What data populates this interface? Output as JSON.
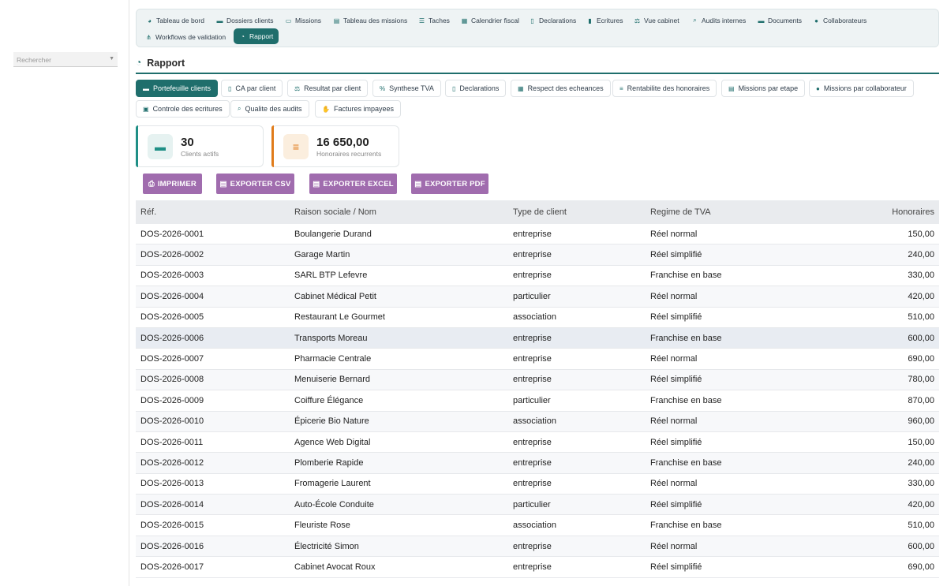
{
  "sidebar": {
    "search_placeholder": "Rechercher"
  },
  "topnav": {
    "items": [
      {
        "label": "Tableau de bord",
        "icon": "dashboard-icon"
      },
      {
        "label": "Dossiers clients",
        "icon": "folder-icon"
      },
      {
        "label": "Missions",
        "icon": "briefcase-icon"
      },
      {
        "label": "Tableau des missions",
        "icon": "table-icon"
      },
      {
        "label": "Taches",
        "icon": "list-icon"
      },
      {
        "label": "Calendrier fiscal",
        "icon": "calendar-icon"
      },
      {
        "label": "Declarations",
        "icon": "document-icon"
      },
      {
        "label": "Ecritures",
        "icon": "book-icon"
      },
      {
        "label": "Vue cabinet",
        "icon": "scale-icon"
      },
      {
        "label": "Audits internes",
        "icon": "search-icon"
      },
      {
        "label": "Documents",
        "icon": "folder-icon"
      },
      {
        "label": "Collaborateurs",
        "icon": "users-icon"
      },
      {
        "label": "Workflows de validation",
        "icon": "workflow-icon"
      },
      {
        "label": "Rapport",
        "icon": "pie-chart-icon",
        "active": true
      }
    ]
  },
  "page": {
    "title": "Rapport"
  },
  "tabs": [
    {
      "label": "Portefeuille clients",
      "icon": "folder-open-icon",
      "active": true
    },
    {
      "label": "CA par client",
      "icon": "invoice-icon"
    },
    {
      "label": "Resultat par client",
      "icon": "scale-icon"
    },
    {
      "label": "Synthese TVA",
      "icon": "percent-icon"
    },
    {
      "label": "Declarations",
      "icon": "document-icon"
    },
    {
      "label": "Respect des echeances",
      "icon": "calendar-check-icon"
    },
    {
      "label": "Rentabilite des honoraires",
      "icon": "coins-icon"
    },
    {
      "label": "Missions par etape",
      "icon": "columns-icon"
    },
    {
      "label": "Missions par collaborateur",
      "icon": "users-icon"
    },
    {
      "label": "Controle des ecritures",
      "icon": "clipboard-check-icon"
    },
    {
      "label": "Qualite des audits",
      "icon": "search-icon"
    },
    {
      "label": "Factures impayees",
      "icon": "hand-money-icon"
    }
  ],
  "kpis": [
    {
      "value": "30",
      "label": "Clients actifs",
      "icon": "folder-open-icon",
      "color": "#1f8f86",
      "bg": "#e6f2f1"
    },
    {
      "value": "16 650,00",
      "label": "Honoraires recurrents",
      "icon": "coins-icon",
      "color": "#e07b1a",
      "bg": "#fbeede"
    }
  ],
  "actions": [
    {
      "label": "IMPRIMER",
      "icon": "print-icon"
    },
    {
      "label": "EXPORTER CSV",
      "icon": "file-icon"
    },
    {
      "label": "EXPORTER EXCEL",
      "icon": "file-icon"
    },
    {
      "label": "EXPORTER PDF",
      "icon": "file-icon"
    }
  ],
  "colors": {
    "accent": "#1f6e6c",
    "button": "#a06cae",
    "header_bg": "#e9ebee"
  },
  "table": {
    "headers": [
      "Réf.",
      "Raison sociale / Nom",
      "Type de client",
      "Regime de TVA",
      "Honoraires"
    ],
    "rows": [
      [
        "DOS-2026-0001",
        "Boulangerie Durand",
        "entreprise",
        "Réel normal",
        "150,00"
      ],
      [
        "DOS-2026-0002",
        "Garage Martin",
        "entreprise",
        "Réel simplifié",
        "240,00"
      ],
      [
        "DOS-2026-0003",
        "SARL BTP Lefevre",
        "entreprise",
        "Franchise en base",
        "330,00"
      ],
      [
        "DOS-2026-0004",
        "Cabinet Médical Petit",
        "particulier",
        "Réel normal",
        "420,00"
      ],
      [
        "DOS-2026-0005",
        "Restaurant Le Gourmet",
        "association",
        "Réel simplifié",
        "510,00"
      ],
      [
        "DOS-2026-0006",
        "Transports Moreau",
        "entreprise",
        "Franchise en base",
        "600,00"
      ],
      [
        "DOS-2026-0007",
        "Pharmacie Centrale",
        "entreprise",
        "Réel normal",
        "690,00"
      ],
      [
        "DOS-2026-0008",
        "Menuiserie Bernard",
        "entreprise",
        "Réel simplifié",
        "780,00"
      ],
      [
        "DOS-2026-0009",
        "Coiffure Élégance",
        "particulier",
        "Franchise en base",
        "870,00"
      ],
      [
        "DOS-2026-0010",
        "Épicerie Bio Nature",
        "association",
        "Réel normal",
        "960,00"
      ],
      [
        "DOS-2026-0011",
        "Agence Web Digital",
        "entreprise",
        "Réel simplifié",
        "150,00"
      ],
      [
        "DOS-2026-0012",
        "Plomberie Rapide",
        "entreprise",
        "Franchise en base",
        "240,00"
      ],
      [
        "DOS-2026-0013",
        "Fromagerie Laurent",
        "entreprise",
        "Réel normal",
        "330,00"
      ],
      [
        "DOS-2026-0014",
        "Auto-École Conduite",
        "particulier",
        "Réel simplifié",
        "420,00"
      ],
      [
        "DOS-2026-0015",
        "Fleuriste Rose",
        "association",
        "Franchise en base",
        "510,00"
      ],
      [
        "DOS-2026-0016",
        "Électricité Simon",
        "entreprise",
        "Réel normal",
        "600,00"
      ],
      [
        "DOS-2026-0017",
        "Cabinet Avocat Roux",
        "entreprise",
        "Réel simplifié",
        "690,00"
      ]
    ],
    "highlighted_row": 5
  }
}
